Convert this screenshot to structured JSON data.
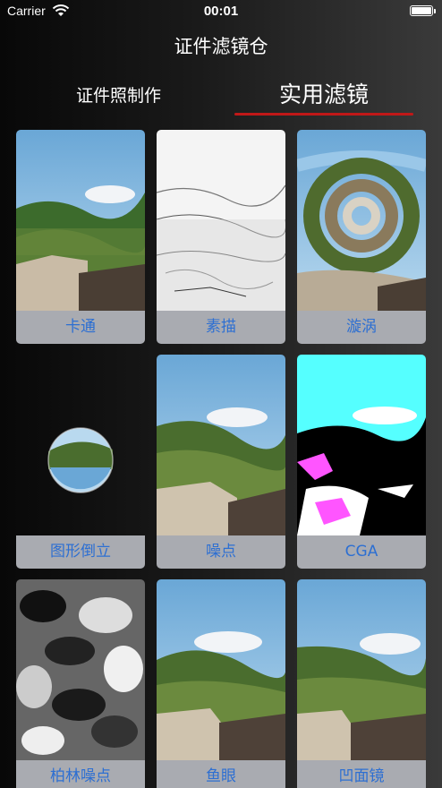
{
  "status": {
    "carrier": "Carrier",
    "time": "00:01"
  },
  "nav": {
    "title": "证件滤镜仓"
  },
  "tabs": [
    {
      "label": "证件照制作",
      "selected": false
    },
    {
      "label": "实用滤镜",
      "selected": true
    }
  ],
  "accent_color": "#c01818",
  "label_color": "#2d6fd2",
  "filters": [
    {
      "label": "卡通",
      "effect": "cartoon"
    },
    {
      "label": "素描",
      "effect": "sketch"
    },
    {
      "label": "漩涡",
      "effect": "twirl"
    },
    {
      "label": "图形倒立",
      "effect": "glass-sphere"
    },
    {
      "label": "噪点",
      "effect": "noise"
    },
    {
      "label": "CGA",
      "effect": "cga"
    },
    {
      "label": "柏林噪点",
      "effect": "perlin-noise"
    },
    {
      "label": "鱼眼",
      "effect": "fisheye"
    },
    {
      "label": "凹面镜",
      "effect": "concave-mirror"
    }
  ]
}
